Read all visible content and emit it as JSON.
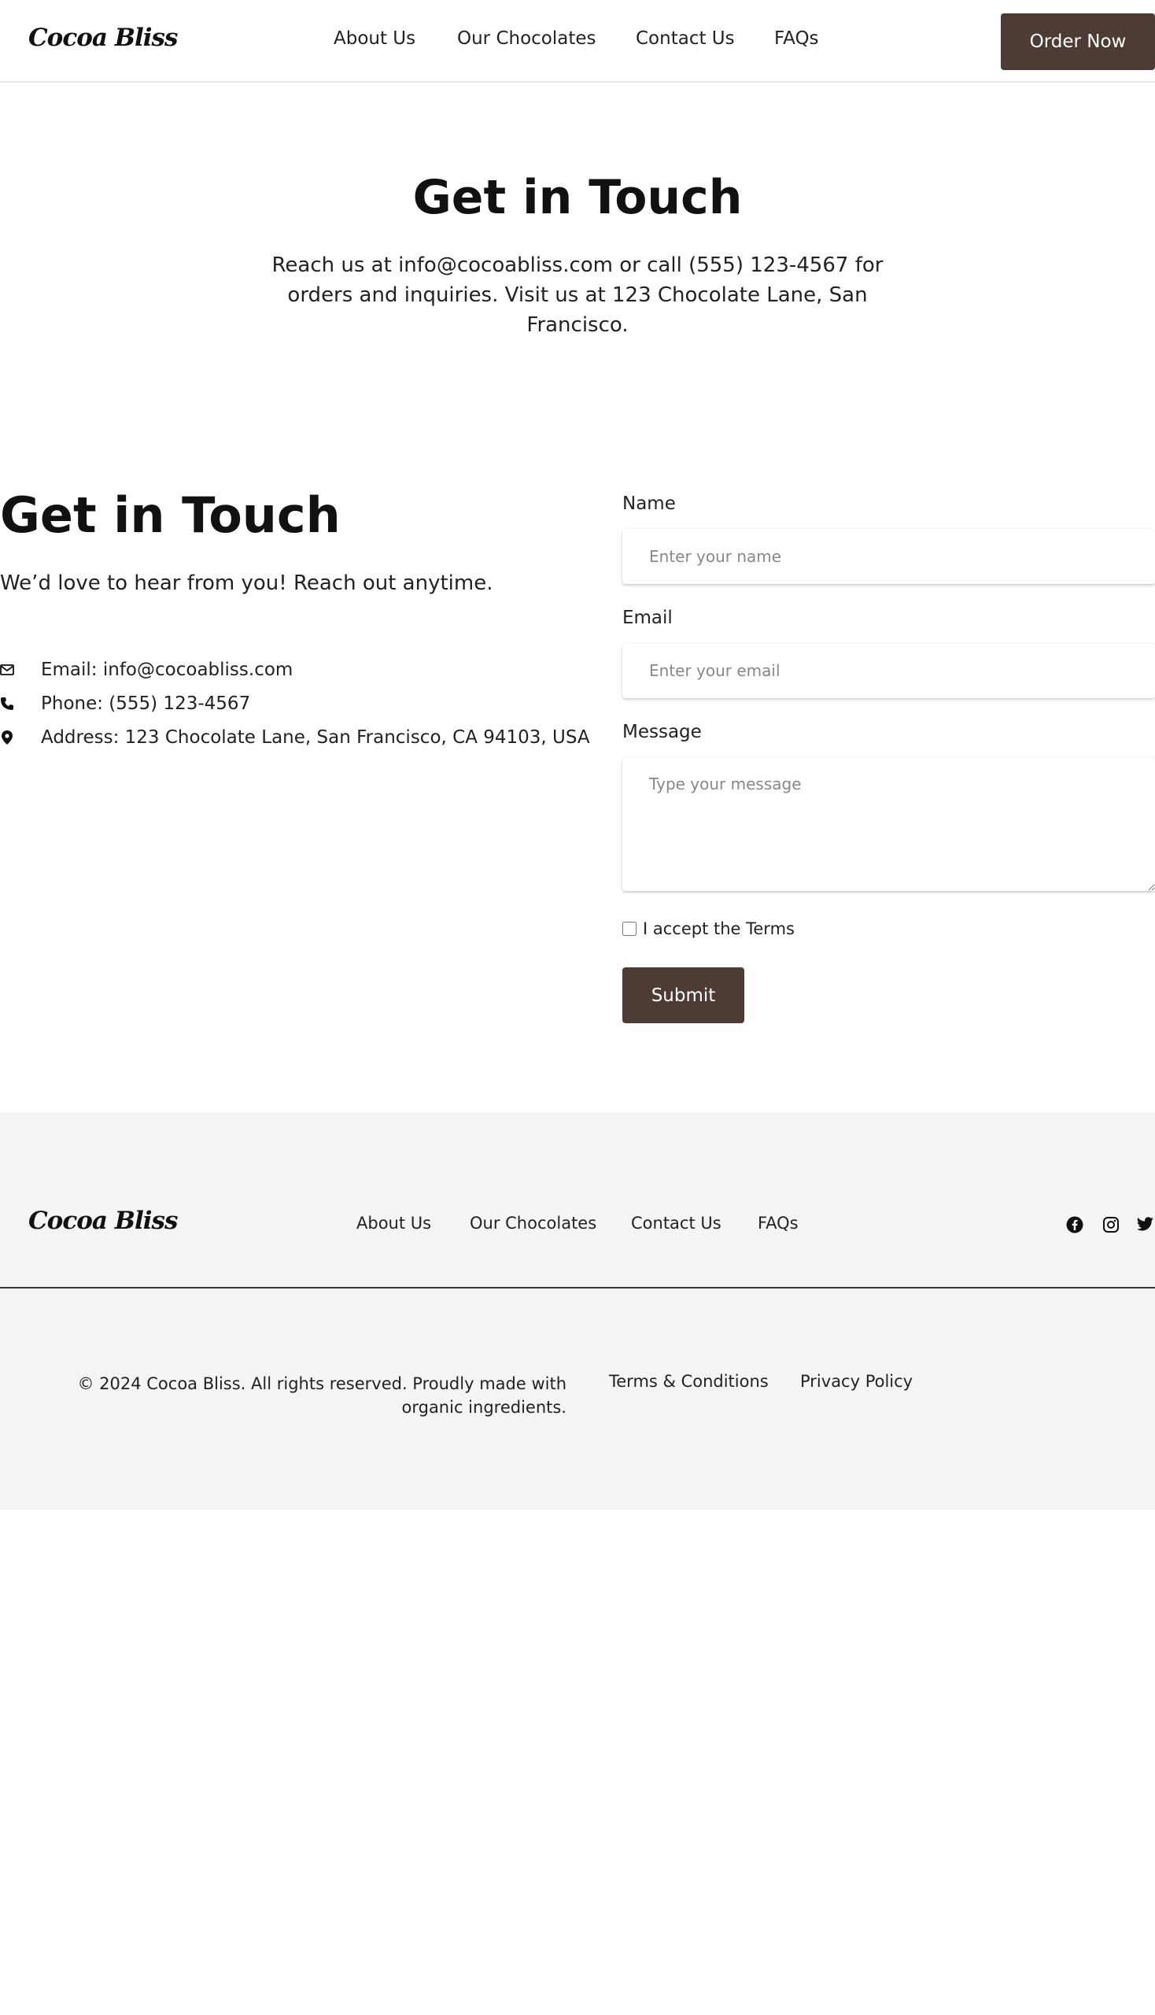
{
  "header": {
    "logo": "Cocoa Bliss",
    "nav": [
      {
        "label": "About Us"
      },
      {
        "label": "Our Chocolates"
      },
      {
        "label": "Contact Us"
      },
      {
        "label": "FAQs"
      }
    ],
    "order_button": "Order Now"
  },
  "hero": {
    "title": "Get in Touch",
    "text": "Reach us at info@cocoabliss.com or call (555) 123-4567 for orders and inquiries. Visit us at 123 Chocolate Lane, San Francisco."
  },
  "contact": {
    "title": "Get in Touch",
    "subtitle": "We’d love to hear from you! Reach out anytime.",
    "items": [
      {
        "icon": "envelope-icon",
        "text": "Email: info@cocoabliss.com"
      },
      {
        "icon": "phone-icon",
        "text": "Phone: (555) 123-4567"
      },
      {
        "icon": "map-pin-icon",
        "text": "Address: 123 Chocolate Lane, San Francisco, CA 94103, USA"
      }
    ]
  },
  "form": {
    "name_label": "Name",
    "name_placeholder": "Enter your name",
    "email_label": "Email",
    "email_placeholder": "Enter your email",
    "message_label": "Message",
    "message_placeholder": "Type your message",
    "terms_label": "I accept the Terms",
    "submit_label": "Submit"
  },
  "footer": {
    "logo": "Cocoa Bliss",
    "nav": [
      {
        "label": "About Us"
      },
      {
        "label": "Our Chocolates"
      },
      {
        "label": "Contact Us"
      },
      {
        "label": "FAQs"
      }
    ],
    "social": [
      "facebook-icon",
      "instagram-icon",
      "twitter-icon"
    ],
    "copyright": "© 2024 Cocoa Bliss. All rights reserved. Proudly made with organic ingredients.",
    "legal": [
      {
        "label": "Terms & Conditions"
      },
      {
        "label": "Privacy Policy"
      }
    ]
  },
  "colors": {
    "brand": "#4e3b33",
    "footer_bg": "#f3f4f6",
    "text": "#111111"
  }
}
